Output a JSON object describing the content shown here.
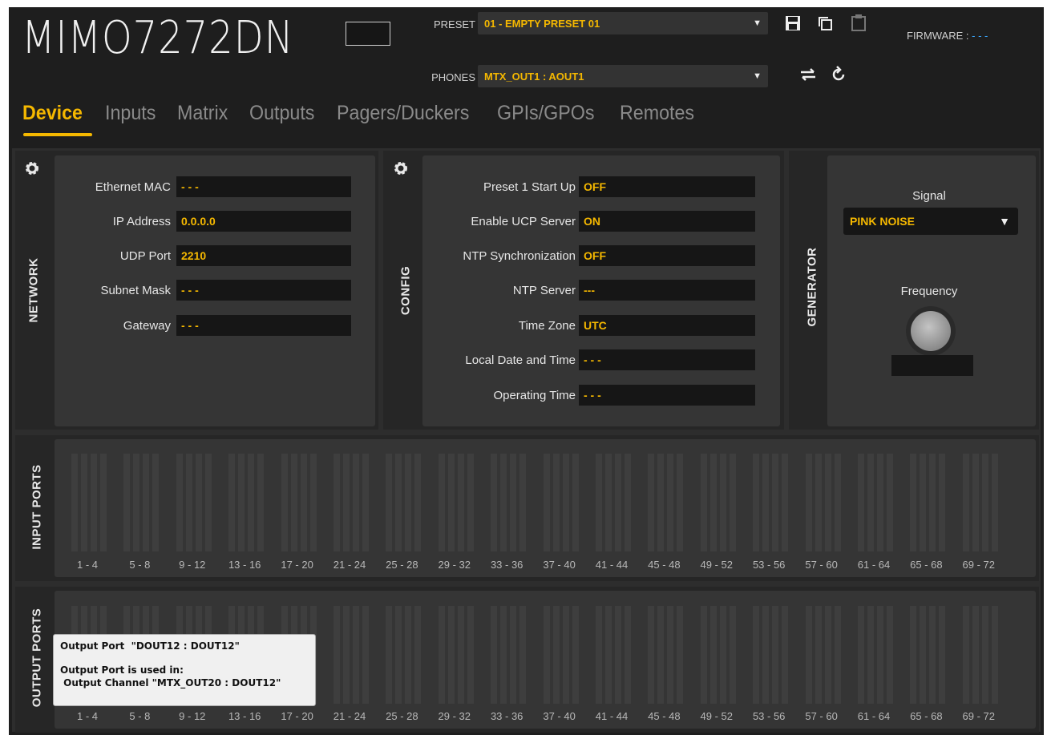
{
  "header": {
    "device_name": "MIMO7272DN",
    "preset_label": "PRESET",
    "preset_value": "01 - EMPTY PRESET 01",
    "phones_label": "PHONES",
    "phones_value": "MTX_OUT1 : AOUT1",
    "firmware_label": "FIRMWARE :",
    "firmware_value": "- - -",
    "icons": [
      "save-icon",
      "copy-icon",
      "paste-icon",
      "swap-icon",
      "refresh-icon"
    ]
  },
  "tabs": [
    "Device",
    "Inputs",
    "Matrix",
    "Outputs",
    "Pagers/Duckers",
    "GPIs/GPOs",
    "Remotes"
  ],
  "network": {
    "title": "NETWORK",
    "rows": [
      {
        "label": "Ethernet MAC",
        "value": "- - -"
      },
      {
        "label": "IP Address",
        "value": "0.0.0.0"
      },
      {
        "label": "UDP Port",
        "value": "2210"
      },
      {
        "label": "Subnet Mask",
        "value": "- - -"
      },
      {
        "label": "Gateway",
        "value": "- - -"
      }
    ]
  },
  "config": {
    "title": "CONFIG",
    "rows": [
      {
        "label": "Preset 1 Start Up",
        "value": "OFF"
      },
      {
        "label": "Enable UCP Server",
        "value": "ON"
      },
      {
        "label": "NTP Synchronization",
        "value": "OFF"
      },
      {
        "label": "NTP Server",
        "value": "---"
      },
      {
        "label": "Time Zone",
        "value": "UTC"
      },
      {
        "label": "Local Date and Time",
        "value": "- - -"
      },
      {
        "label": "Operating Time",
        "value": "- - -"
      }
    ]
  },
  "generator": {
    "title": "GENERATOR",
    "signal_label": "Signal",
    "signal_value": "PINK NOISE",
    "frequency_label": "Frequency"
  },
  "input_ports": {
    "title": "INPUT PORTS",
    "groups": [
      "1 - 4",
      "5 - 8",
      "9 - 12",
      "13 - 16",
      "17 - 20",
      "21 - 24",
      "25 - 28",
      "29 - 32",
      "33 - 36",
      "37 - 40",
      "41 - 44",
      "45 - 48",
      "49 - 52",
      "53 - 56",
      "57 - 60",
      "61 - 64",
      "65 - 68",
      "69 - 72"
    ]
  },
  "output_ports": {
    "title": "OUTPUT PORTS",
    "groups": [
      "1 - 4",
      "5 - 8",
      "9 - 12",
      "13 - 16",
      "17 - 20",
      "21 - 24",
      "25 - 28",
      "29 - 32",
      "33 - 36",
      "37 - 40",
      "41 - 44",
      "45 - 48",
      "49 - 52",
      "53 - 56",
      "57 - 60",
      "61 - 64",
      "65 - 68",
      "69 - 72"
    ]
  },
  "tooltip": {
    "line1": "Output Port  \"DOUT12 : DOUT12\"",
    "line2": "Output Port is used in:",
    "line3": " Output Channel \"MTX_OUT20 : DOUT12\""
  }
}
